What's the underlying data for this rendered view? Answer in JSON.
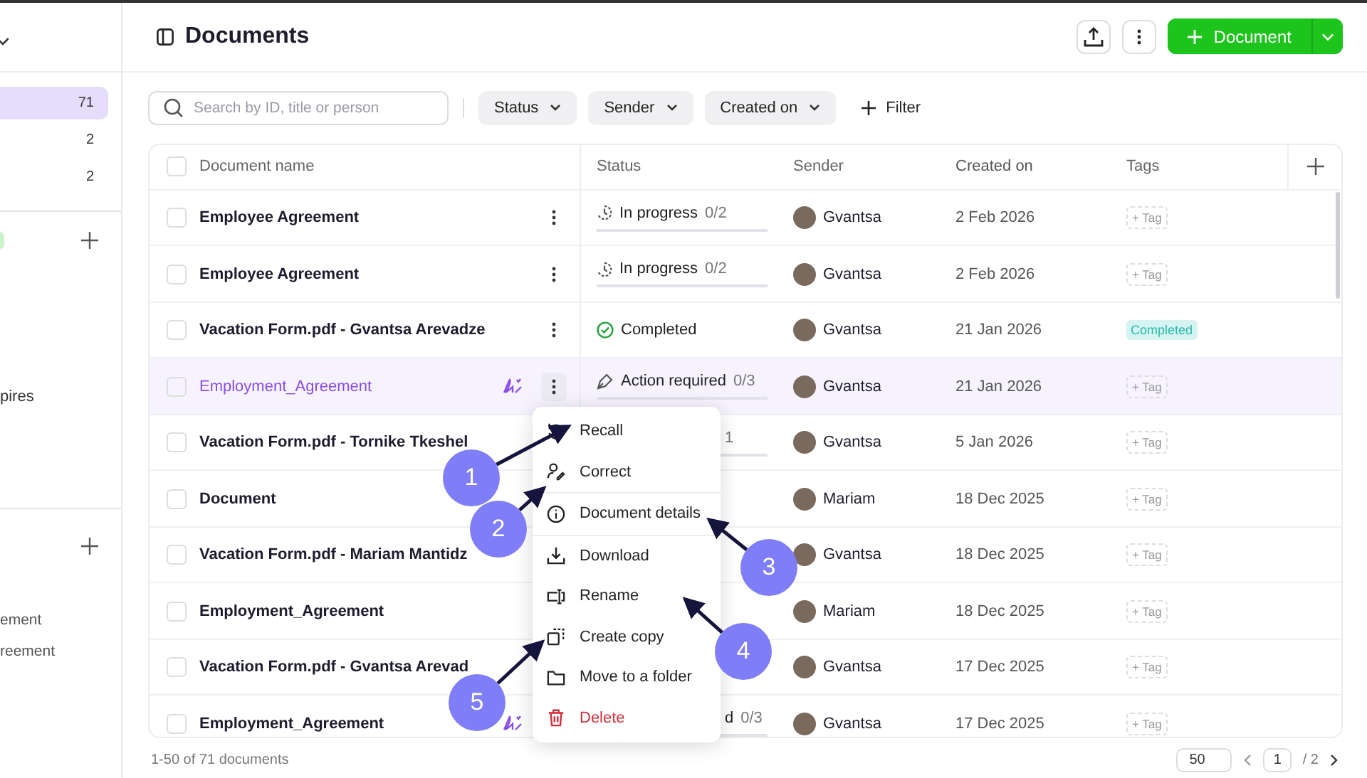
{
  "sidebar": {
    "counts": [
      {
        "count": "71",
        "selected": true
      },
      {
        "count": "2",
        "selected": false
      },
      {
        "count": "2",
        "selected": false
      }
    ],
    "partial_items": [
      {
        "label": "pires"
      },
      {
        "label": "ement"
      },
      {
        "label": "reement"
      }
    ]
  },
  "header": {
    "title": "Documents",
    "new_button": "Document"
  },
  "toolbar": {
    "search": {
      "placeholder": "Search by ID, title or person"
    },
    "filters": [
      "Status",
      "Sender",
      "Created on"
    ],
    "add_filter": "Filter"
  },
  "table": {
    "select_all": {
      "checked": false
    },
    "columns": [
      "Document name",
      "Status",
      "Sender",
      "Created on",
      "Tags"
    ],
    "rows": [
      {
        "name": "Employee Agreement",
        "checked": false,
        "selected": false,
        "signing": false,
        "status": {
          "kind": "in_progress",
          "text": "In progress",
          "count": "0/2"
        },
        "sender": "Gvantsa",
        "created": "2 Feb 2026",
        "tag": {
          "kind": "add",
          "label": "+ Tag"
        }
      },
      {
        "name": "Employee Agreement",
        "checked": false,
        "selected": false,
        "signing": false,
        "status": {
          "kind": "in_progress",
          "text": "In progress",
          "count": "0/2"
        },
        "sender": "Gvantsa",
        "created": "2 Feb 2026",
        "tag": {
          "kind": "add",
          "label": "+ Tag"
        }
      },
      {
        "name": "Vacation Form.pdf - Gvantsa Arevadze",
        "checked": false,
        "selected": false,
        "signing": false,
        "status": {
          "kind": "completed",
          "text": "Completed"
        },
        "sender": "Gvantsa",
        "created": "21 Jan 2026",
        "tag": {
          "kind": "label",
          "label": "Completed"
        }
      },
      {
        "name": "Employment_Agreement",
        "checked": false,
        "selected": true,
        "signing": true,
        "status": {
          "kind": "action_required",
          "text": "Action required",
          "count": "0/3"
        },
        "sender": "Gvantsa",
        "created": "21 Jan 2026",
        "tag": {
          "kind": "add",
          "label": "+ Tag"
        }
      },
      {
        "name": "Vacation Form.pdf - Tornike Tkeshel",
        "checked": false,
        "selected": false,
        "signing": false,
        "status": {
          "kind": "covered",
          "count": "1"
        },
        "sender": "Gvantsa",
        "created": "5 Jan 2026",
        "tag": {
          "kind": "add",
          "label": "+ Tag"
        }
      },
      {
        "name": "Document",
        "checked": false,
        "selected": false,
        "signing": false,
        "status": {
          "kind": "hidden"
        },
        "sender": "Mariam",
        "created": "18 Dec 2025",
        "tag": {
          "kind": "add",
          "label": "+ Tag"
        }
      },
      {
        "name": "Vacation Form.pdf - Mariam Mantidz",
        "checked": false,
        "selected": false,
        "signing": false,
        "status": {
          "kind": "hidden"
        },
        "sender": "Gvantsa",
        "created": "18 Dec 2025",
        "tag": {
          "kind": "add",
          "label": "+ Tag"
        }
      },
      {
        "name": "Employment_Agreement",
        "checked": false,
        "selected": false,
        "signing": false,
        "status": {
          "kind": "hidden"
        },
        "sender": "Mariam",
        "created": "18 Dec 2025",
        "tag": {
          "kind": "add",
          "label": "+ Tag"
        }
      },
      {
        "name": "Vacation Form.pdf - Gvantsa Arevad",
        "checked": false,
        "selected": false,
        "signing": false,
        "status": {
          "kind": "hidden"
        },
        "sender": "Gvantsa",
        "created": "17 Dec 2025",
        "tag": {
          "kind": "add",
          "label": "+ Tag"
        }
      },
      {
        "name": "Employment_Agreement",
        "checked": false,
        "selected": false,
        "signing": true,
        "status": {
          "kind": "covered",
          "text": "d",
          "count": "0/3"
        },
        "sender": "Gvantsa",
        "created": "17 Dec 2025",
        "tag": {
          "kind": "add",
          "label": "+ Tag"
        }
      }
    ]
  },
  "context_menu": [
    {
      "kind": "recall",
      "label": "Recall",
      "divider_after": false
    },
    {
      "kind": "correct",
      "label": "Correct",
      "divider_after": true
    },
    {
      "kind": "details",
      "label": "Document details",
      "divider_after": true
    },
    {
      "kind": "download",
      "label": "Download",
      "divider_after": false
    },
    {
      "kind": "rename",
      "label": "Rename",
      "divider_after": false
    },
    {
      "kind": "copy",
      "label": "Create copy",
      "divider_after": false
    },
    {
      "kind": "folder",
      "label": "Move to a folder",
      "divider_after": false
    },
    {
      "kind": "delete",
      "label": "Delete",
      "divider_after": false
    }
  ],
  "annotations": [
    {
      "label": "1"
    },
    {
      "label": "2"
    },
    {
      "label": "3"
    },
    {
      "label": "4"
    },
    {
      "label": "5"
    }
  ],
  "footer": {
    "summary": "1-50 of 71 documents",
    "page_size": "50",
    "page": "1",
    "page_total": "/ 2"
  }
}
